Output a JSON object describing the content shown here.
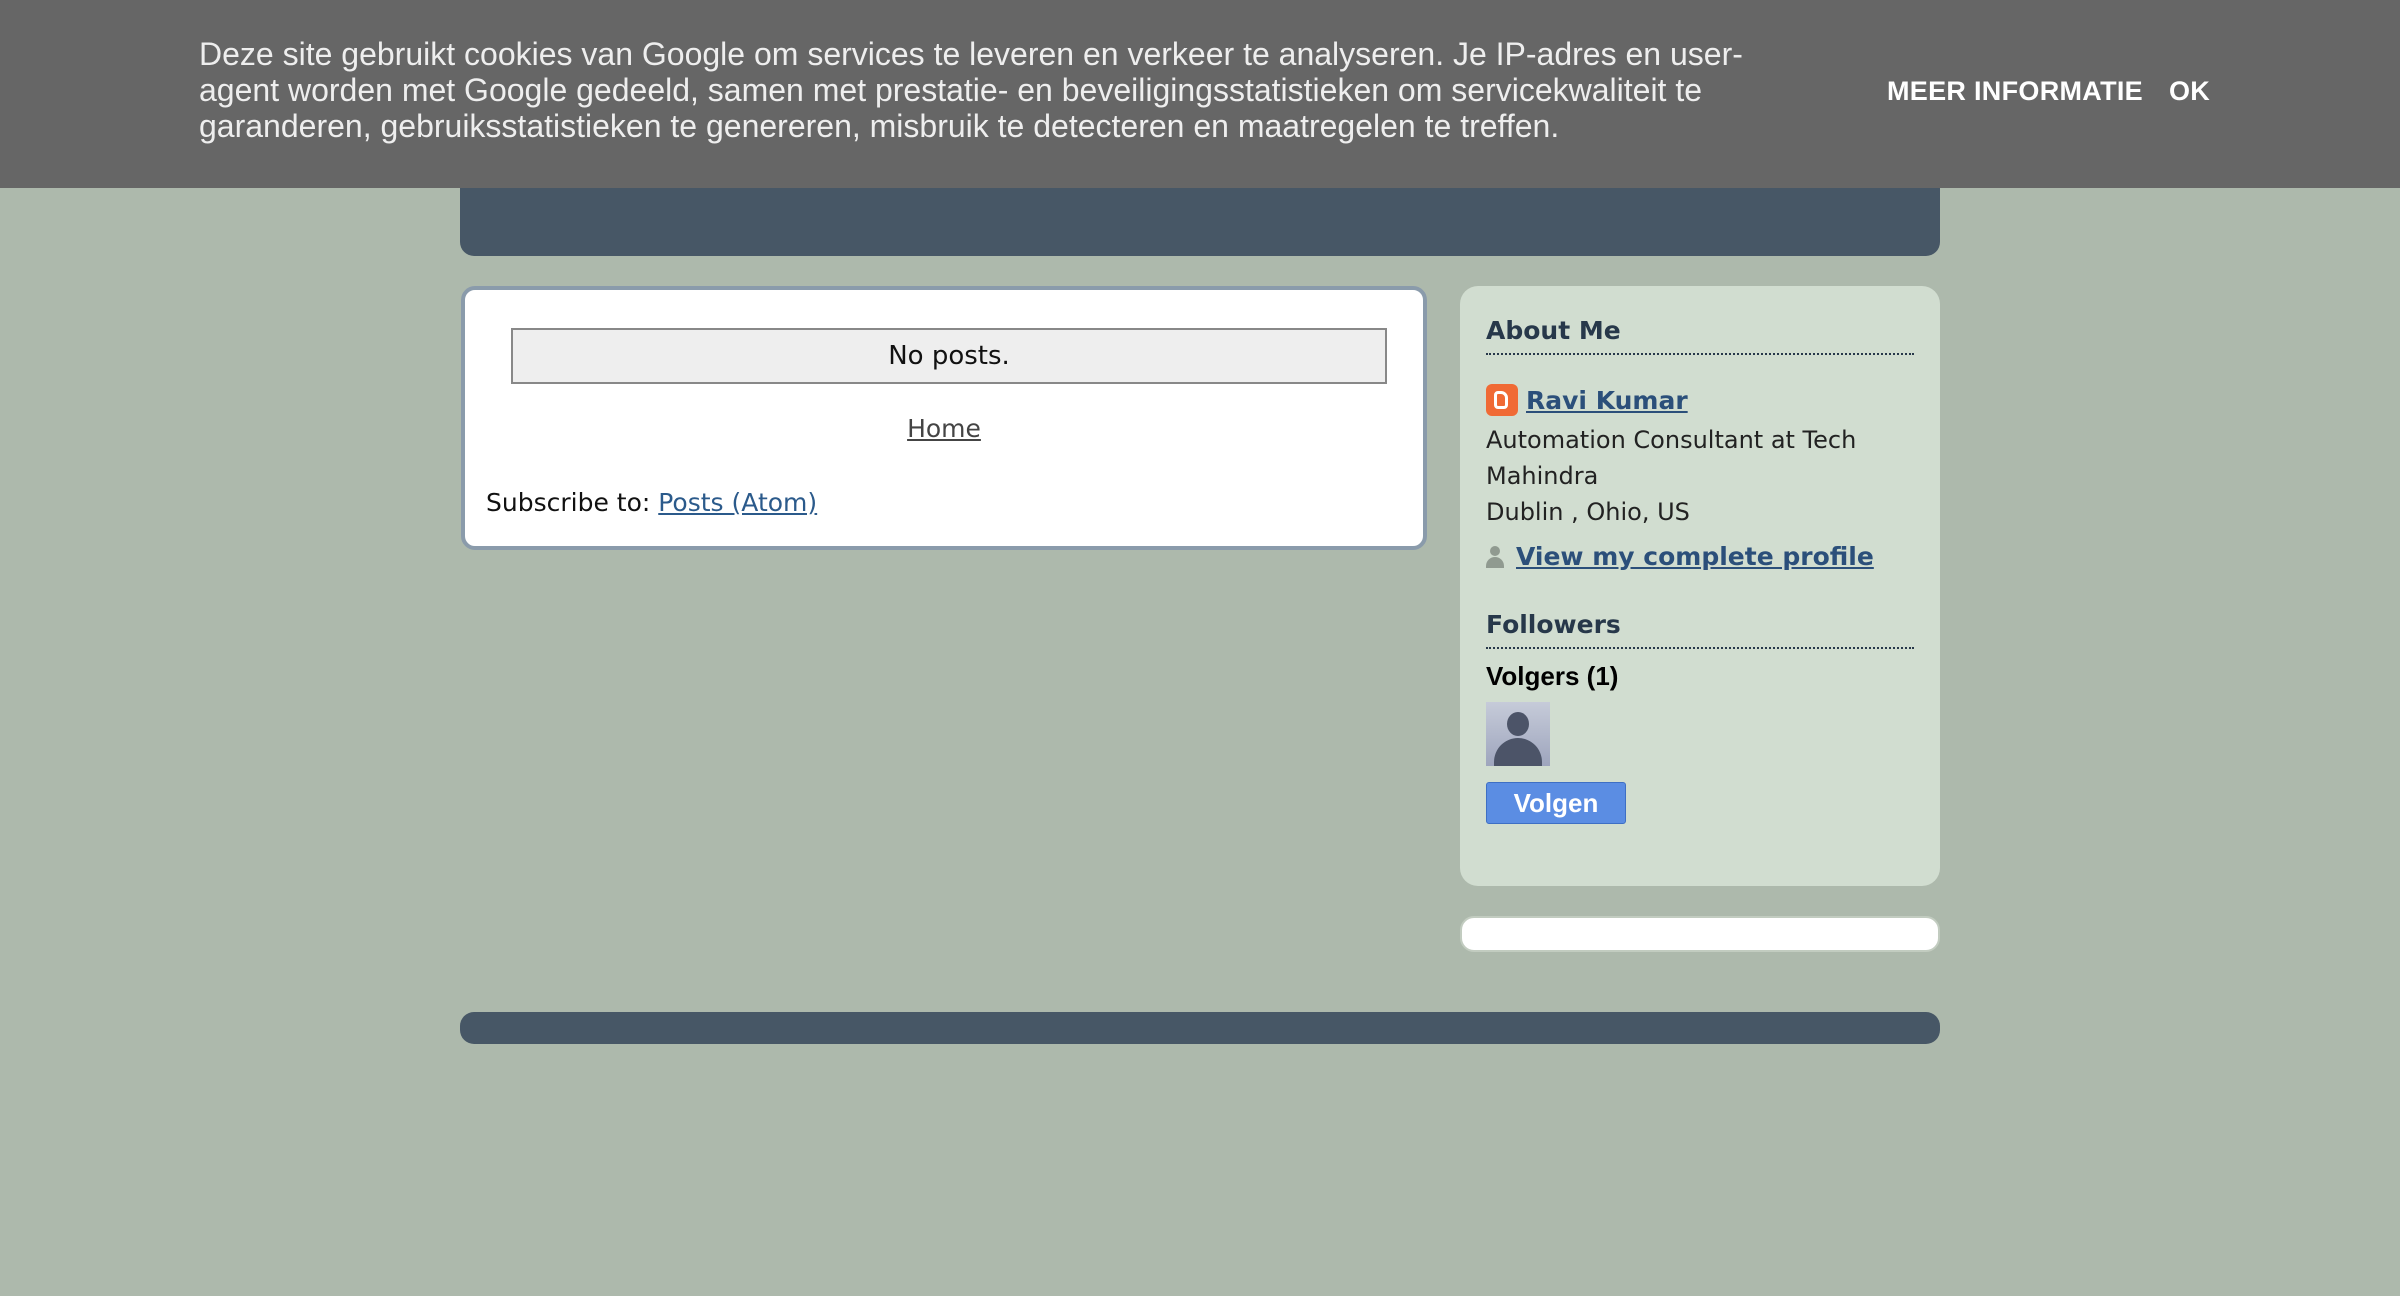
{
  "cookie_bar": {
    "message": "Deze site gebruikt cookies van Google om services te leveren en verkeer te analyseren. Je IP-adres en user-agent worden met Google gedeeld, samen met prestatie- en beveiligingsstatistieken om servicekwaliteit te garanderen, gebruiksstatistieken te genereren, misbruik te detecteren en maatregelen te treffen.",
    "more_info_label": "MEER INFORMATIE",
    "ok_label": "OK"
  },
  "header": {
    "title": ""
  },
  "main": {
    "no_posts": "No posts.",
    "home_link": "Home",
    "subscribe_label": "Subscribe to:",
    "subscribe_link": "Posts (Atom)"
  },
  "sidebar": {
    "about_title": "About Me",
    "profile_name": "Ravi Kumar",
    "profile_description": "Automation Consultant at Tech Mahindra",
    "profile_location": "Dublin , Ohio, US",
    "view_profile_link": "View my complete profile",
    "followers_title": "Followers",
    "followers_count_label": "Volgers (1)",
    "follow_button_label": "Volgen"
  },
  "colors": {
    "background": "#adb9ac",
    "header": "#475766",
    "cookie_bar": "#666666",
    "link": "#2b4f7a",
    "follow_button": "#5b8de3",
    "blogger_icon": "#f06a35"
  }
}
